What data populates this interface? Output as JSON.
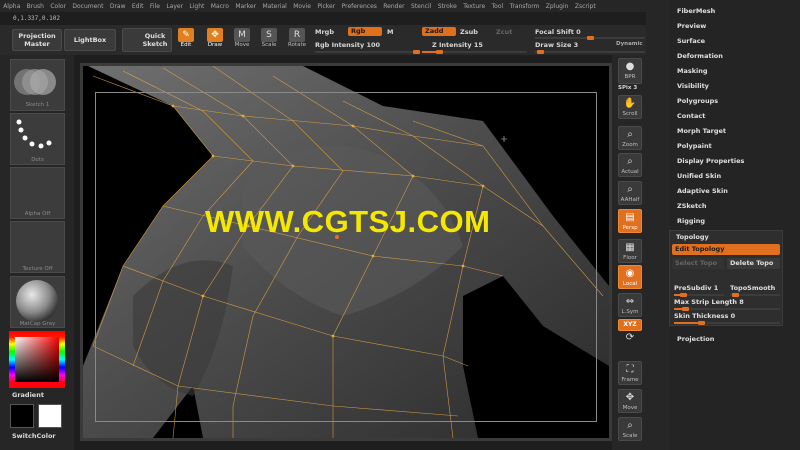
{
  "menu": [
    "Alpha",
    "Brush",
    "Color",
    "Document",
    "Draw",
    "Edit",
    "File",
    "Layer",
    "Light",
    "Macro",
    "Marker",
    "Material",
    "Movie",
    "Picker",
    "Preferences",
    "Render",
    "Stencil",
    "Stroke",
    "Texture",
    "Tool",
    "Transform",
    "Zplugin",
    "Zscript"
  ],
  "coords": "0,1.337,0.102",
  "toolbar": {
    "projection_master": "Projection Master",
    "lightbox": "LightBox",
    "quick_sketch": "Quick Sketch",
    "edit": "Edit",
    "draw": "Draw",
    "move": "Move",
    "scale": "Scale",
    "rotate": "Rotate",
    "mrgb": "Mrgb",
    "rgb": "Rgb",
    "m": "M",
    "rgb_intensity": "Rgb Intensity 100",
    "zadd": "Zadd",
    "zsub": "Zsub",
    "zcut": "Zcut",
    "z_intensity": "Z Intensity 15",
    "focal_shift": "Focal Shift 0",
    "draw_size": "Draw Size 3",
    "dynamic": "Dynamic"
  },
  "left_shelf": {
    "sketch": "Sketch 1",
    "dots": "Dots",
    "alpha": "Alpha Off",
    "texture": "Texture Off",
    "matcap": "MatCap Gray",
    "gradient": "Gradient",
    "switch_color": "SwitchColor"
  },
  "watermark": "WWW.CGTSJ.COM",
  "right_shelf": {
    "bpr": "BPR",
    "spix": "SPix 3",
    "scroll": "Scroll",
    "zoom": "Zoom",
    "actual": "Actual",
    "aahalf": "AAHalf",
    "persp": "Persp",
    "floor": "Floor",
    "local": "Local",
    "lsym": "L.Sym",
    "xyz": "XYZ",
    "frame": "Frame",
    "move": "Move",
    "scale": "Scale"
  },
  "tool_panel": {
    "items": [
      "FiberMesh",
      "Preview",
      "Surface",
      "Deformation",
      "Masking",
      "Visibility",
      "Polygroups",
      "Contact",
      "Morph Target",
      "Polypaint",
      "Display Properties",
      "Unified Skin",
      "Adaptive Skin",
      "ZSketch",
      "Rigging"
    ],
    "topology": {
      "header": "Topology",
      "edit_topology": "Edit Topology",
      "select_topo": "Select Topo",
      "delete_topo": "Delete Topo",
      "presubdiv": "PreSubdiv 1",
      "toposmooth": "TopoSmooth",
      "max_strip_length": "Max Strip Length 8",
      "skin_thickness": "Skin Thickness 0"
    },
    "projection": "Projection"
  },
  "colors": {
    "accent": "#e07020",
    "watermark": "#f5e800",
    "mesh": "#e8a840"
  }
}
